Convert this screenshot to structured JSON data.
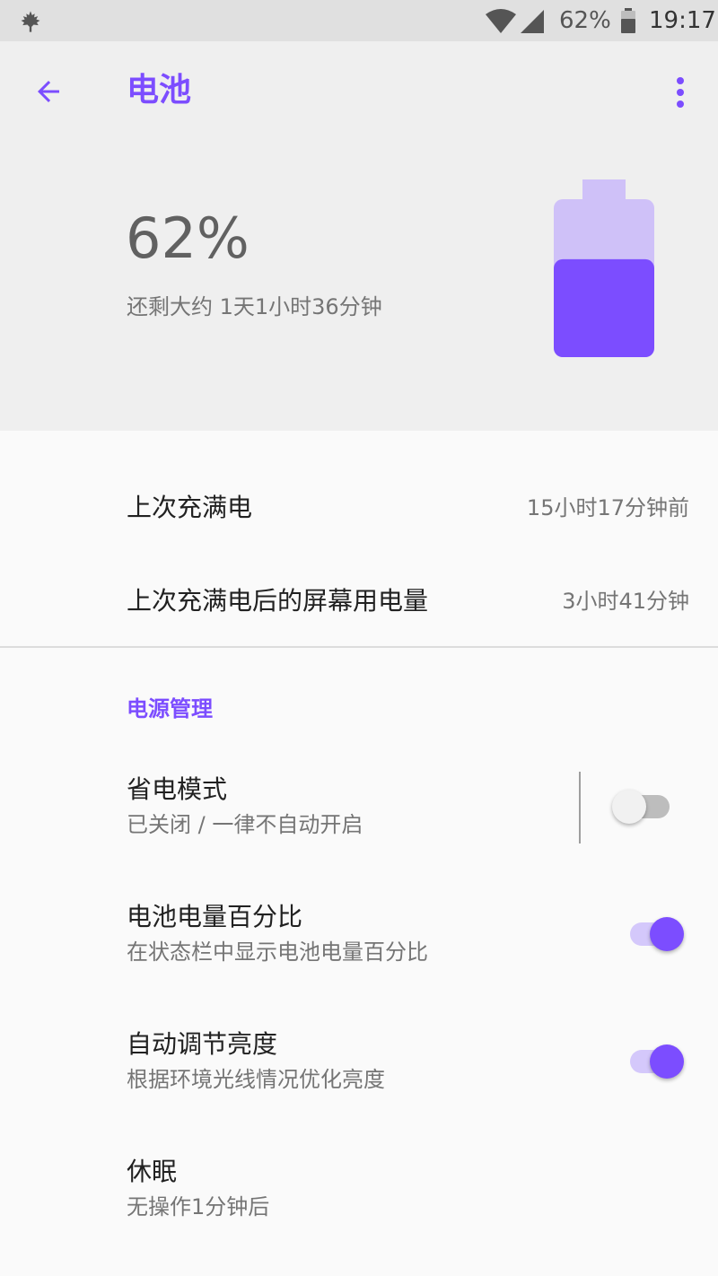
{
  "status_bar": {
    "battery_percent": "62%",
    "time": "19:17",
    "icons": [
      "maple-leaf-icon",
      "wifi-icon",
      "cell-signal-icon",
      "battery-icon"
    ]
  },
  "header": {
    "title": "电池",
    "battery_level": "62%",
    "battery_level_value": 0.62,
    "remaining": "还剩大约 1天1小时36分钟"
  },
  "info": [
    {
      "label": "上次充满电",
      "value": "15小时17分钟前"
    },
    {
      "label": "上次充满电后的屏幕用电量",
      "value": "3小时41分钟"
    }
  ],
  "power_section": {
    "title": "电源管理",
    "items": [
      {
        "title": "省电模式",
        "subtitle": "已关闭 / 一律不自动开启",
        "toggle": "off"
      },
      {
        "title": "电池电量百分比",
        "subtitle": "在状态栏中显示电池电量百分比",
        "toggle": "on"
      },
      {
        "title": "自动调节亮度",
        "subtitle": "根据环境光线情况优化亮度",
        "toggle": "on"
      },
      {
        "title": "休眠",
        "subtitle": "无操作1分钟后"
      }
    ]
  },
  "colors": {
    "accent": "#7c4dff",
    "accent_light": "#cfc1f8",
    "header_bg": "#efefef",
    "status_bar_bg": "#e0e0e0"
  }
}
